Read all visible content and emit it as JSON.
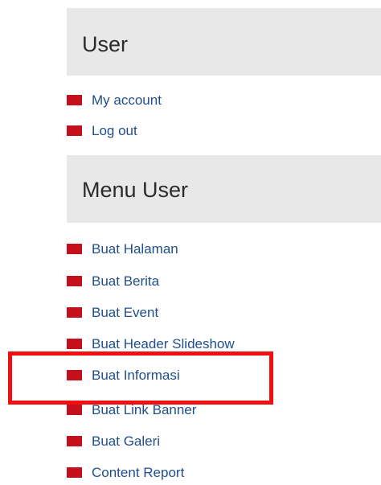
{
  "user_block": {
    "title": "User",
    "links": [
      {
        "label": "My account"
      },
      {
        "label": "Log out"
      }
    ]
  },
  "menu_user_block": {
    "title": "Menu User",
    "links": [
      {
        "label": "Buat Halaman"
      },
      {
        "label": "Buat Berita"
      },
      {
        "label": "Buat Event"
      },
      {
        "label": "Buat Header Slideshow"
      },
      {
        "label": "Buat Informasi"
      },
      {
        "label": "Buat Link Banner"
      },
      {
        "label": "Buat Galeri"
      },
      {
        "label": "Content Report"
      }
    ]
  },
  "colors": {
    "bullet": "#c4101a",
    "link": "#1f4e8c",
    "header_bg": "#e8e8e8",
    "highlight": "#f10f12"
  }
}
